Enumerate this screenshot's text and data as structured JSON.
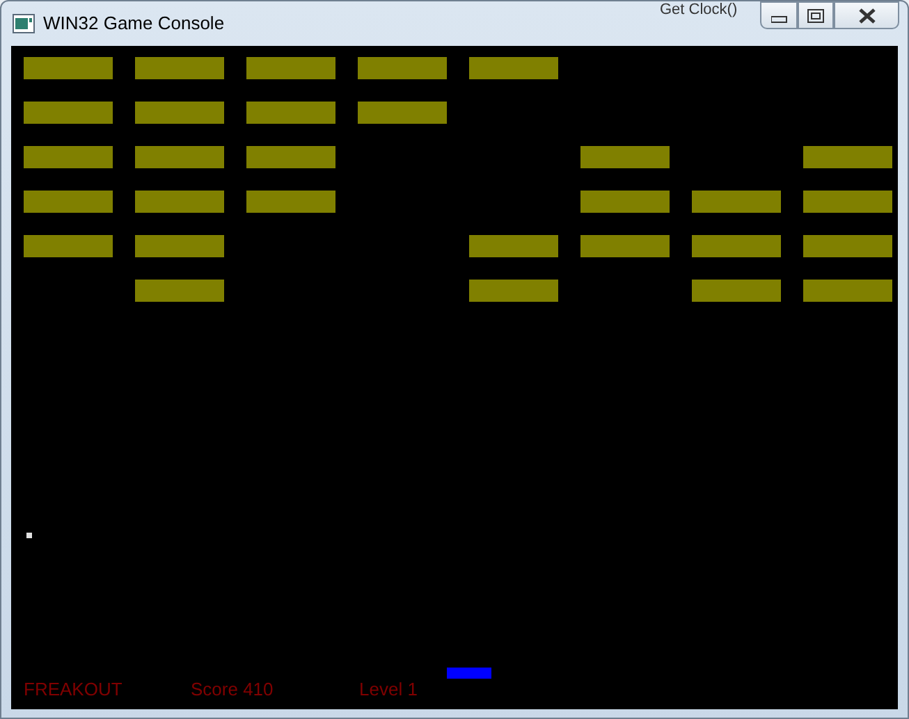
{
  "background_text": "Get Clock()",
  "window": {
    "title": "WIN32 Game Console"
  },
  "bricks": [
    {
      "cells": [
        true,
        true,
        true,
        true,
        true,
        false,
        false,
        false
      ]
    },
    {
      "cells": [
        true,
        true,
        true,
        true,
        false,
        false,
        false,
        false
      ]
    },
    {
      "cells": [
        true,
        true,
        true,
        false,
        false,
        true,
        false,
        true
      ]
    },
    {
      "cells": [
        true,
        true,
        true,
        false,
        false,
        true,
        true,
        true
      ]
    },
    {
      "cells": [
        true,
        true,
        false,
        false,
        true,
        true,
        true,
        true
      ]
    },
    {
      "cells": [
        false,
        true,
        false,
        false,
        true,
        false,
        true,
        true
      ]
    }
  ],
  "status": [
    {
      "text": "FREAKOUT"
    },
    {
      "text": "Score 410"
    },
    {
      "text": "Level 1"
    }
  ]
}
